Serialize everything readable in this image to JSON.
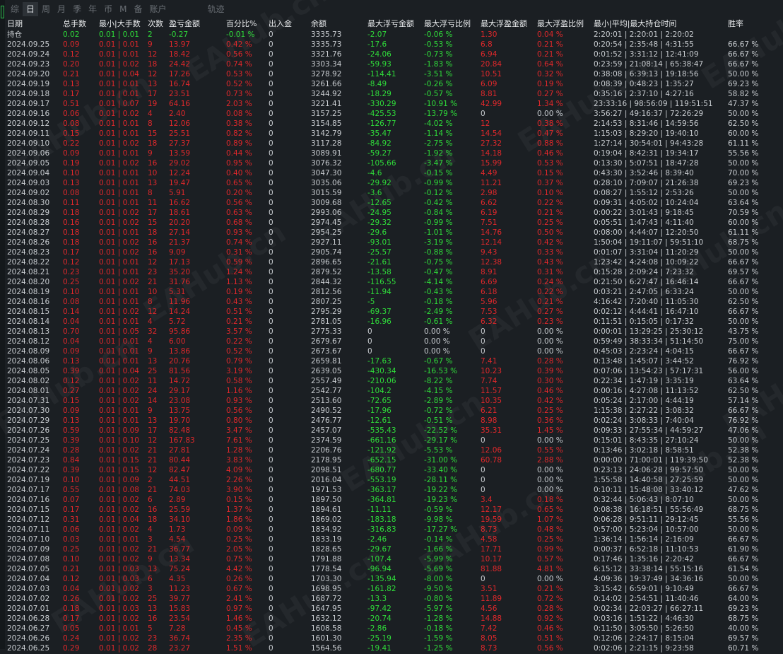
{
  "tabs": [
    "综",
    "日",
    "周",
    "月",
    "季",
    "年",
    "币",
    "M",
    "备",
    "账户",
    "轨迹"
  ],
  "active_tab": 1,
  "watermark": "EAHub.cn",
  "colors": {
    "positive": "#2fdc3a",
    "negative": "#e0282b",
    "text": "#c8ccd0",
    "background": "#1b1f23"
  },
  "headers": [
    "日期",
    "总手数",
    "最小|大手数",
    "次数",
    "盈亏金额",
    "百分比%",
    "出入金",
    "余额",
    "最大浮亏金额",
    "最大浮亏比例",
    "最大浮盈金额",
    "最大浮盈比例",
    "最小|平均|最大持仓时间",
    "胜率"
  ],
  "summary": [
    "持仓",
    "0.02",
    "0.01 | 0.01",
    "2",
    "-0.27",
    "-0.01 %",
    "0",
    "3335.73",
    "-2.07",
    "-0.06 %",
    "1.30",
    "0.04 %",
    "2:20:01 | 2:20:01 | 2:20:02",
    ""
  ],
  "rows": [
    [
      "2024.09.25",
      "0.09",
      "0.01 | 0.01",
      "9",
      "13.97",
      "0.42 %",
      "0",
      "3335.73",
      "-17.6",
      "-0.53 %",
      "6.8",
      "0.21 %",
      "0:20:54 | 2:35:48 | 4:31:55",
      "66.67 %"
    ],
    [
      "2024.09.24",
      "0.12",
      "0.01 | 0.01",
      "12",
      "18.42",
      "0.56 %",
      "0",
      "3321.76",
      "-24.06",
      "-0.73 %",
      "6.94",
      "0.21 %",
      "0:01:52 | 3:31:12 | 12:41:09",
      "66.67 %"
    ],
    [
      "2024.09.23",
      "0.20",
      "0.01 | 0.02",
      "18",
      "24.42",
      "0.74 %",
      "0",
      "3303.34",
      "-59.93",
      "-1.83 %",
      "20.84",
      "0.64 %",
      "0:23:59 | 21:08:14 | 65:38:47",
      "66.67 %"
    ],
    [
      "2024.09.20",
      "0.21",
      "0.01 | 0.04",
      "12",
      "17.26",
      "0.53 %",
      "0",
      "3278.92",
      "-114.41",
      "-3.51 %",
      "10.51",
      "0.32 %",
      "0:38:08 | 6:39:13 | 19:18:56",
      "50.00 %"
    ],
    [
      "2024.09.19",
      "0.13",
      "0.01 | 0.01",
      "13",
      "16.74",
      "0.52 %",
      "0",
      "3261.66",
      "-8.49",
      "-0.26 %",
      "6.09",
      "0.19 %",
      "0:08:39 | 0:48:23 | 1:35:27",
      "69.23 %"
    ],
    [
      "2024.09.18",
      "0.17",
      "0.01 | 0.01",
      "17",
      "23.51",
      "0.73 %",
      "0",
      "3244.92",
      "-18.29",
      "-0.57 %",
      "8.81",
      "0.27 %",
      "0:35:16 | 2:37:10 | 4:27:16",
      "58.82 %"
    ],
    [
      "2024.09.17",
      "0.51",
      "0.01 | 0.07",
      "19",
      "64.16",
      "2.03 %",
      "0",
      "3221.41",
      "-330.29",
      "-10.91 %",
      "42.99",
      "1.34 %",
      "23:33:16 | 98:56:09 | 119:51:51",
      "47.37 %"
    ],
    [
      "2024.09.16",
      "0.06",
      "0.01 | 0.02",
      "4",
      "2.40",
      "0.08 %",
      "0",
      "3157.25",
      "-425.53",
      "-13.79 %",
      "0",
      "0.00 %",
      "3:56:27 | 49:16:37 | 72:26:29",
      "50.00 %"
    ],
    [
      "2024.09.12",
      "0.08",
      "0.01 | 0.01",
      "8",
      "12.06",
      "0.38 %",
      "0",
      "3154.85",
      "-126.77",
      "-4.02 %",
      "12",
      "0.38 %",
      "2:14:53 | 8:31:46 | 14:59:56",
      "62.50 %"
    ],
    [
      "2024.09.11",
      "0.15",
      "0.01 | 0.01",
      "15",
      "25.51",
      "0.82 %",
      "0",
      "3142.79",
      "-35.47",
      "-1.14 %",
      "14.54",
      "0.47 %",
      "1:15:03 | 8:29:20 | 19:40:10",
      "60.00 %"
    ],
    [
      "2024.09.10",
      "0.22",
      "0.01 | 0.02",
      "18",
      "27.37",
      "0.89 %",
      "0",
      "3117.28",
      "-84.92",
      "-2.75 %",
      "27.32",
      "0.88 %",
      "1:27:14 | 30:54:01 | 94:43:28",
      "61.11 %"
    ],
    [
      "2024.09.06",
      "0.09",
      "0.01 | 0.01",
      "9",
      "13.59",
      "0.44 %",
      "0",
      "3089.91",
      "-59.27",
      "-1.92 %",
      "14.18",
      "0.46 %",
      "0:19:04 | 8:42:31 | 19:34:17",
      "55.56 %"
    ],
    [
      "2024.09.05",
      "0.19",
      "0.01 | 0.02",
      "16",
      "29.02",
      "0.95 %",
      "0",
      "3076.32",
      "-105.66",
      "-3.47 %",
      "15.99",
      "0.53 %",
      "0:13:30 | 5:07:51 | 18:47:28",
      "50.00 %"
    ],
    [
      "2024.09.04",
      "0.10",
      "0.01 | 0.01",
      "10",
      "12.24",
      "0.40 %",
      "0",
      "3047.30",
      "-4.6",
      "-0.15 %",
      "4.49",
      "0.15 %",
      "0:43:30 | 3:52:46 | 8:39:40",
      "70.00 %"
    ],
    [
      "2024.09.03",
      "0.13",
      "0.01 | 0.01",
      "13",
      "19.47",
      "0.65 %",
      "0",
      "3035.06",
      "-29.92",
      "-0.99 %",
      "11.21",
      "0.37 %",
      "0:28:10 | 7:09:07 | 21:26:38",
      "69.23 %"
    ],
    [
      "2024.09.02",
      "0.08",
      "0.01 | 0.01",
      "8",
      "5.91",
      "0.20 %",
      "0",
      "3015.59",
      "-3.6",
      "-0.12 %",
      "2.98",
      "0.10 %",
      "0:08:27 | 1:55:12 | 2:53:26",
      "50.00 %"
    ],
    [
      "2024.08.30",
      "0.11",
      "0.01 | 0.01",
      "11",
      "16.62",
      "0.56 %",
      "0",
      "3009.68",
      "-12.65",
      "-0.42 %",
      "6.62",
      "0.22 %",
      "0:09:31 | 4:05:02 | 10:24:04",
      "63.64 %"
    ],
    [
      "2024.08.29",
      "0.18",
      "0.01 | 0.02",
      "17",
      "18.61",
      "0.63 %",
      "0",
      "2993.06",
      "-24.95",
      "-0.84 %",
      "6.19",
      "0.21 %",
      "0:00:22 | 3:01:43 | 9:18:45",
      "70.59 %"
    ],
    [
      "2024.08.28",
      "0.16",
      "0.01 | 0.02",
      "15",
      "20.20",
      "0.68 %",
      "0",
      "2974.45",
      "-29.32",
      "-0.99 %",
      "7.51",
      "0.25 %",
      "0:05:51 | 1:47:43 | 4:11:40",
      "60.00 %"
    ],
    [
      "2024.08.27",
      "0.18",
      "0.01 | 0.01",
      "18",
      "27.14",
      "0.93 %",
      "0",
      "2954.25",
      "-29.6",
      "-1.01 %",
      "14.76",
      "0.50 %",
      "0:08:00 | 4:44:07 | 12:20:50",
      "61.11 %"
    ],
    [
      "2024.08.26",
      "0.18",
      "0.01 | 0.02",
      "16",
      "21.37",
      "0.74 %",
      "0",
      "2927.11",
      "-93.01",
      "-3.19 %",
      "12.14",
      "0.42 %",
      "1:50:04 | 19:11:07 | 59:51:10",
      "68.75 %"
    ],
    [
      "2024.08.23",
      "0.17",
      "0.01 | 0.02",
      "16",
      "9.09",
      "0.31 %",
      "0",
      "2905.74",
      "-25.57",
      "-0.88 %",
      "9.43",
      "0.33 %",
      "0:01:07 | 3:31:04 | 11:20:29",
      "50.00 %"
    ],
    [
      "2024.08.22",
      "0.12",
      "0.01 | 0.01",
      "12",
      "17.13",
      "0.59 %",
      "0",
      "2896.65",
      "-21.61",
      "-0.75 %",
      "12.38",
      "0.43 %",
      "1:23:42 | 4:24:08 | 10:09:22",
      "66.67 %"
    ],
    [
      "2024.08.21",
      "0.23",
      "0.01 | 0.01",
      "23",
      "35.20",
      "1.24 %",
      "0",
      "2879.52",
      "-13.58",
      "-0.47 %",
      "8.91",
      "0.31 %",
      "0:15:28 | 2:09:24 | 7:23:32",
      "69.57 %"
    ],
    [
      "2024.08.20",
      "0.25",
      "0.01 | 0.02",
      "21",
      "31.76",
      "1.13 %",
      "0",
      "2844.32",
      "-116.55",
      "-4.14 %",
      "6.69",
      "0.24 %",
      "0:21:50 | 6:27:47 | 16:46:14",
      "66.67 %"
    ],
    [
      "2024.08.19",
      "0.10",
      "0.01 | 0.01",
      "10",
      "5.31",
      "0.19 %",
      "0",
      "2812.56",
      "-11.94",
      "-0.43 %",
      "6.18",
      "0.22 %",
      "0:03:21 | 2:47:05 | 6:33:24",
      "50.00 %"
    ],
    [
      "2024.08.16",
      "0.08",
      "0.01 | 0.01",
      "8",
      "11.96",
      "0.43 %",
      "0",
      "2807.25",
      "-5",
      "-0.18 %",
      "5.96",
      "0.21 %",
      "4:16:42 | 7:20:40 | 11:05:30",
      "62.50 %"
    ],
    [
      "2024.08.15",
      "0.14",
      "0.01 | 0.02",
      "12",
      "14.24",
      "0.51 %",
      "0",
      "2795.29",
      "-69.37",
      "-2.49 %",
      "7.53",
      "0.27 %",
      "0:02:12 | 4:44:41 | 16:47:10",
      "66.67 %"
    ],
    [
      "2024.08.14",
      "0.04",
      "0.01 | 0.01",
      "4",
      "5.72",
      "0.21 %",
      "0",
      "2781.05",
      "-16.96",
      "-0.61 %",
      "6.32",
      "0.23 %",
      "0:11:51 | 0:15:05 | 0:17:32",
      "50.00 %"
    ],
    [
      "2024.08.13",
      "0.70",
      "0.01 | 0.05",
      "32",
      "95.86",
      "3.57 %",
      "0",
      "2775.33",
      "0",
      "0.00 %",
      "0",
      "0.00 %",
      "0:00:01 | 13:29:25 | 25:30:12",
      "43.75 %"
    ],
    [
      "2024.08.12",
      "0.04",
      "0.01 | 0.01",
      "4",
      "6.00",
      "0.22 %",
      "0",
      "2679.67",
      "0",
      "0.00 %",
      "0",
      "0.00 %",
      "0:59:49 | 38:33:34 | 51:14:50",
      "75.00 %"
    ],
    [
      "2024.08.09",
      "0.09",
      "0.01 | 0.01",
      "9",
      "13.86",
      "0.52 %",
      "0",
      "2673.67",
      "0",
      "0.00 %",
      "0",
      "0.00 %",
      "0:45:03 | 2:23:24 | 4:04:15",
      "66.67 %"
    ],
    [
      "2024.08.06",
      "0.13",
      "0.01 | 0.01",
      "13",
      "20.76",
      "0.79 %",
      "0",
      "2659.81",
      "-17.63",
      "-0.67 %",
      "7.41",
      "0.28 %",
      "0:13:48 | 1:45:07 | 3:44:52",
      "76.92 %"
    ],
    [
      "2024.08.05",
      "0.39",
      "0.01 | 0.04",
      "25",
      "81.56",
      "3.19 %",
      "0",
      "2639.05",
      "-430.34",
      "-16.53 %",
      "10.23",
      "0.39 %",
      "0:07:06 | 13:54:23 | 57:17:31",
      "56.00 %"
    ],
    [
      "2024.08.02",
      "0.12",
      "0.01 | 0.02",
      "11",
      "14.72",
      "0.58 %",
      "0",
      "2557.49",
      "-210.06",
      "-8.22 %",
      "7.74",
      "0.30 %",
      "0:22:34 | 1:47:19 | 3:35:19",
      "63.64 %"
    ],
    [
      "2024.08.01",
      "0.27",
      "0.01 | 0.02",
      "24",
      "29.17",
      "1.16 %",
      "0",
      "2542.77",
      "-104.2",
      "-4.15 %",
      "11.57",
      "0.46 %",
      "0:00:16 | 4:27:08 | 11:13:52",
      "62.50 %"
    ],
    [
      "2024.07.31",
      "0.15",
      "0.01 | 0.02",
      "14",
      "23.08",
      "0.93 %",
      "0",
      "2513.60",
      "-72.65",
      "-2.89 %",
      "10.35",
      "0.42 %",
      "0:05:24 | 2:17:00 | 4:44:19",
      "57.14 %"
    ],
    [
      "2024.07.30",
      "0.09",
      "0.01 | 0.01",
      "9",
      "13.75",
      "0.56 %",
      "0",
      "2490.52",
      "-17.96",
      "-0.72 %",
      "6.21",
      "0.25 %",
      "1:15:38 | 2:27:22 | 3:08:32",
      "66.67 %"
    ],
    [
      "2024.07.29",
      "0.13",
      "0.01 | 0.01",
      "13",
      "19.70",
      "0.80 %",
      "0",
      "2476.77",
      "-12.61",
      "-0.51 %",
      "8.98",
      "0.36 %",
      "0:02:24 | 3:08:33 | 7:40:04",
      "76.92 %"
    ],
    [
      "2024.07.26",
      "0.59",
      "0.01 | 0.09",
      "17",
      "82.48",
      "3.47 %",
      "0",
      "2457.07",
      "-535.43",
      "-22.52 %",
      "35.31",
      "1.45 %",
      "0:09:33 | 27:55:34 | 44:59:27",
      "47.06 %"
    ],
    [
      "2024.07.25",
      "0.39",
      "0.01 | 0.10",
      "12",
      "167.83",
      "7.61 %",
      "0",
      "2374.59",
      "-661.16",
      "-29.17 %",
      "0",
      "0.00 %",
      "0:15:01 | 8:43:35 | 27:10:24",
      "50.00 %"
    ],
    [
      "2024.07.24",
      "0.28",
      "0.01 | 0.02",
      "21",
      "27.81",
      "1.28 %",
      "0",
      "2206.76",
      "-121.92",
      "-5.53 %",
      "12.06",
      "0.55 %",
      "0:13:46 | 3:02:18 | 8:58:51",
      "52.38 %"
    ],
    [
      "2024.07.23",
      "0.84",
      "0.01 | 0.15",
      "21",
      "80.44",
      "3.83 %",
      "0",
      "2178.95",
      "-652.15",
      "-31.00 %",
      "60.78",
      "2.88 %",
      "0:00:00 | 71:00:01 | 119:39:50",
      "52.38 %"
    ],
    [
      "2024.07.22",
      "0.39",
      "0.01 | 0.15",
      "12",
      "82.47",
      "4.09 %",
      "0",
      "2098.51",
      "-680.77",
      "-33.40 %",
      "0",
      "0.00 %",
      "0:23:13 | 24:06:28 | 99:57:50",
      "50.00 %"
    ],
    [
      "2024.07.19",
      "0.10",
      "0.01 | 0.09",
      "2",
      "44.51",
      "2.26 %",
      "0",
      "2016.04",
      "-553.19",
      "-28.11 %",
      "0",
      "0.00 %",
      "1:55:58 | 14:40:58 | 27:25:59",
      "50.00 %"
    ],
    [
      "2024.07.17",
      "0.55",
      "0.01 | 0.08",
      "21",
      "74.03",
      "3.90 %",
      "0",
      "1971.53",
      "-363.17",
      "-19.22 %",
      "0",
      "0.00 %",
      "0:10:11 | 15:48:08 | 33:40:12",
      "47.62 %"
    ],
    [
      "2024.07.16",
      "0.07",
      "0.01 | 0.02",
      "6",
      "2.89",
      "0.15 %",
      "0",
      "1897.50",
      "-364.81",
      "-19.23 %",
      "3.4",
      "0.18 %",
      "0:32:44 | 5:06:43 | 8:07:10",
      "50.00 %"
    ],
    [
      "2024.07.15",
      "0.17",
      "0.01 | 0.02",
      "16",
      "25.59",
      "1.37 %",
      "0",
      "1894.61",
      "-11.11",
      "-0.59 %",
      "12.17",
      "0.65 %",
      "0:08:38 | 16:18:51 | 55:56:49",
      "68.75 %"
    ],
    [
      "2024.07.12",
      "0.31",
      "0.01 | 0.04",
      "18",
      "34.10",
      "1.86 %",
      "0",
      "1869.02",
      "-183.18",
      "-9.98 %",
      "19.59",
      "1.07 %",
      "0:06:28 | 9:51:11 | 29:12:45",
      "55.56 %"
    ],
    [
      "2024.07.11",
      "0.06",
      "0.01 | 0.02",
      "4",
      "1.73",
      "0.09 %",
      "0",
      "1834.92",
      "-316.83",
      "-17.27 %",
      "8.73",
      "0.48 %",
      "0:57:00 | 5:23:04 | 10:57:00",
      "50.00 %"
    ],
    [
      "2024.07.10",
      "0.03",
      "0.01 | 0.01",
      "3",
      "4.54",
      "0.25 %",
      "0",
      "1833.19",
      "-2.46",
      "-0.14 %",
      "4.58",
      "0.25 %",
      "1:36:14 | 1:56:14 | 2:16:09",
      "66.67 %"
    ],
    [
      "2024.07.09",
      "0.25",
      "0.01 | 0.02",
      "21",
      "36.77",
      "2.05 %",
      "0",
      "1828.65",
      "-29.67",
      "-1.66 %",
      "17.71",
      "0.99 %",
      "0:00:37 | 6:52:18 | 11:10:53",
      "61.90 %"
    ],
    [
      "2024.07.08",
      "0.10",
      "0.01 | 0.02",
      "9",
      "13.34",
      "0.75 %",
      "0",
      "1791.88",
      "-107.4",
      "-5.99 %",
      "10.17",
      "0.57 %",
      "0:17:46 | 1:35:16 | 2:20:42",
      "66.67 %"
    ],
    [
      "2024.07.05",
      "0.21",
      "0.01 | 0.03",
      "13",
      "75.24",
      "4.42 %",
      "0",
      "1778.54",
      "-96.94",
      "-5.69 %",
      "81.88",
      "4.81 %",
      "6:15:12 | 33:38:14 | 55:15:16",
      "61.54 %"
    ],
    [
      "2024.07.04",
      "0.12",
      "0.01 | 0.03",
      "6",
      "4.35",
      "0.26 %",
      "0",
      "1703.30",
      "-135.94",
      "-8.00 %",
      "0",
      "0.00 %",
      "4:09:36 | 19:37:49 | 34:36:16",
      "50.00 %"
    ],
    [
      "2024.07.03",
      "0.04",
      "0.01 | 0.02",
      "3",
      "11.23",
      "0.67 %",
      "0",
      "1698.95",
      "-161.82",
      "-9.50 %",
      "3.51",
      "0.21 %",
      "3:15:42 | 6:59:01 | 9:10:49",
      "66.67 %"
    ],
    [
      "2024.07.02",
      "0.26",
      "0.01 | 0.02",
      "25",
      "39.77",
      "2.41 %",
      "0",
      "1687.72",
      "-13.3",
      "-0.80 %",
      "11.89",
      "0.72 %",
      "0:14:02 | 2:54:51 | 11:40:46",
      "64.00 %"
    ],
    [
      "2024.07.01",
      "0.18",
      "0.01 | 0.03",
      "13",
      "15.83",
      "0.97 %",
      "0",
      "1647.95",
      "-97.42",
      "-5.97 %",
      "4.56",
      "0.28 %",
      "0:02:34 | 22:03:27 | 66:27:11",
      "69.23 %"
    ],
    [
      "2024.06.28",
      "0.17",
      "0.01 | 0.02",
      "16",
      "23.54",
      "1.46 %",
      "0",
      "1632.12",
      "-20.74",
      "-1.28 %",
      "14.88",
      "0.92 %",
      "0:03:16 | 1:51:22 | 4:46:30",
      "68.75 %"
    ],
    [
      "2024.06.27",
      "0.05",
      "0.01 | 0.01",
      "5",
      "7.28",
      "0.45 %",
      "0",
      "1608.58",
      "-2.86",
      "-0.18 %",
      "7.42",
      "0.46 %",
      "0:11:50 | 3:05:50 | 5:26:50",
      "40.00 %"
    ],
    [
      "2024.06.26",
      "0.24",
      "0.01 | 0.02",
      "23",
      "36.74",
      "2.35 %",
      "0",
      "1601.30",
      "-25.19",
      "-1.59 %",
      "8.05",
      "0.51 %",
      "0:12:06 | 2:24:17 | 8:15:04",
      "69.57 %"
    ],
    [
      "2024.06.25",
      "0.29",
      "0.01 | 0.02",
      "28",
      "23.27",
      "1.51 %",
      "0",
      "1564.56",
      "-19.41",
      "-1.25 %",
      "8.73",
      "0.56 %",
      "0:02:06 | 2:21:15 | 9:23:58",
      "60.71 %"
    ]
  ]
}
